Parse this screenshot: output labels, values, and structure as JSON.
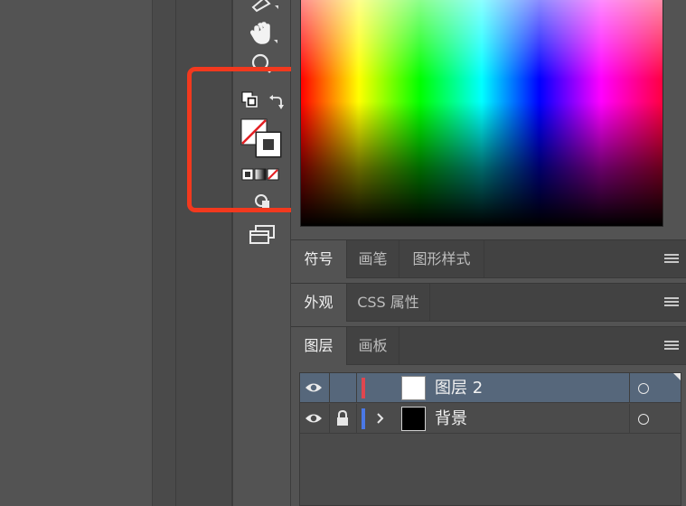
{
  "tabbars": [
    {
      "tabs": [
        {
          "label": "符号",
          "active": true
        },
        {
          "label": "画笔",
          "active": false
        },
        {
          "label": "图形样式",
          "active": false
        }
      ]
    },
    {
      "tabs": [
        {
          "label": "外观",
          "active": true
        },
        {
          "label": "CSS 属性",
          "active": false
        }
      ]
    },
    {
      "tabs": [
        {
          "label": "图层",
          "active": true
        },
        {
          "label": "画板",
          "active": false
        }
      ]
    }
  ],
  "layers": [
    {
      "name": "图层 2",
      "selected": true,
      "locked": false,
      "expandable": false,
      "color": "#e0464f",
      "thumb": "white"
    },
    {
      "name": "背景",
      "selected": false,
      "locked": true,
      "expandable": true,
      "color": "#4a78e6",
      "thumb": "black"
    }
  ],
  "icons": {
    "tools": [
      "pen-icon",
      "hand-icon",
      "zoom-icon",
      "default-fill-stroke-icon",
      "swap-fill-stroke-icon",
      "fill-none-icon",
      "stroke-icon",
      "color-mode-icon",
      "draw-mode-icon",
      "screen-mode-icon"
    ],
    "layer_row": [
      "eye-icon",
      "lock-icon",
      "expand-chevron-icon",
      "target-circle-icon"
    ]
  },
  "colors": {
    "highlight": "#f2391e",
    "selected_row": "#56677b",
    "panel_bg": "#535353"
  }
}
